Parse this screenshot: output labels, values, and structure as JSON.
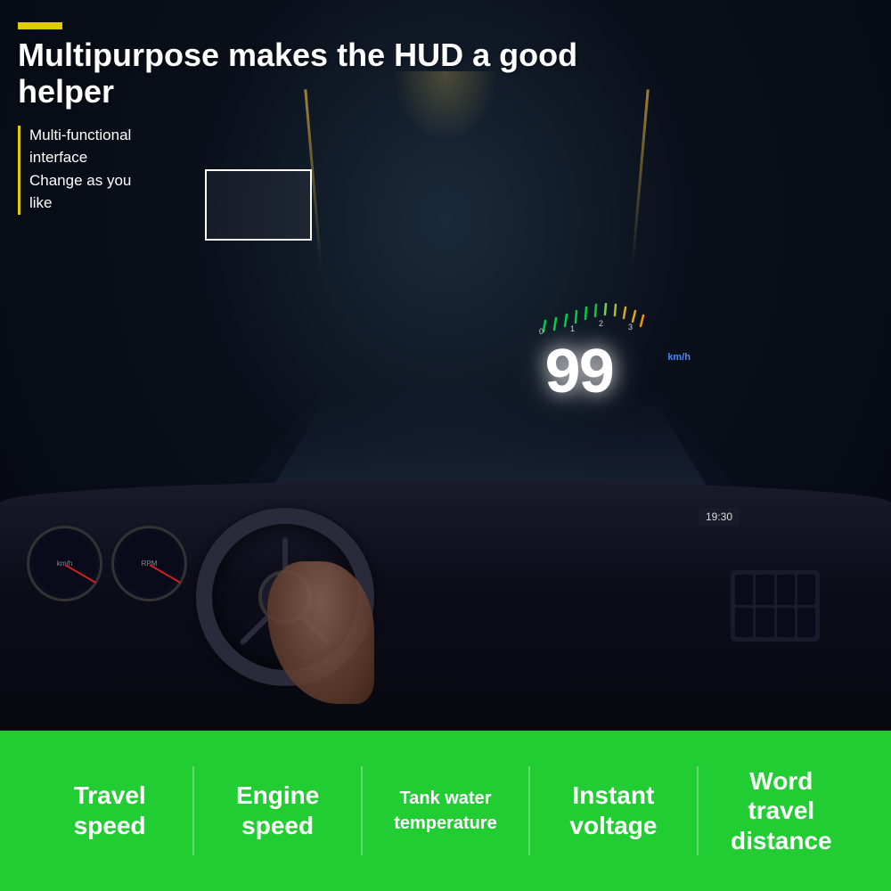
{
  "header": {
    "yellow_bar": "",
    "title_line1": "Multipurpose makes the HUD a good",
    "title_line2": "helper",
    "subtitle_line1": "Multi-functional",
    "subtitle_line2": "interface",
    "subtitle_line3": "Change as you",
    "subtitle_line4": "like"
  },
  "hud": {
    "speed": "99",
    "unit": "km/h",
    "time": "19:30"
  },
  "features": [
    {
      "label": "Travel\nspeed",
      "size": "large"
    },
    {
      "label": "Engine\nspeed",
      "size": "large"
    },
    {
      "label": "Tank water\ntemperature",
      "size": "small"
    },
    {
      "label": "Instant\nvoltage",
      "size": "large"
    },
    {
      "label": "Word\ntravel\ndistance",
      "size": "large"
    }
  ],
  "colors": {
    "background": "#0a0a1a",
    "green_bar": "#22cc33",
    "yellow_accent": "#ddcc00",
    "white_text": "#ffffff",
    "hud_speed": "#ffffff",
    "hud_unit": "#4488ff",
    "rpm_color": "#00cc44"
  }
}
